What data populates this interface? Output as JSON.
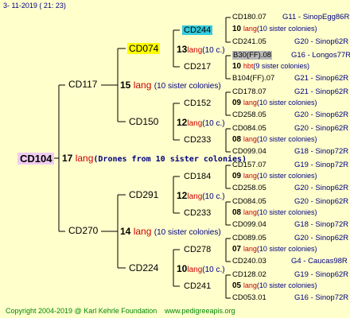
{
  "date": "3- 11-2019 (  21: 23)",
  "root": {
    "name": "CD104",
    "count": "17",
    "lang": "lang",
    "sister": "(Drones from 10 sister colonies)"
  },
  "g1": [
    {
      "name": "CD117",
      "count": "15",
      "lang": "lang",
      "sister": "(10 sister colonies)"
    },
    {
      "name": "CD270",
      "count": "14",
      "lang": "lang",
      "sister": "(10 sister colonies)"
    }
  ],
  "g2": [
    {
      "name": "CD074",
      "count": "13",
      "lang": "lang",
      "sister": "(10 c.)"
    },
    {
      "name": "CD150",
      "count": "12",
      "lang": "lang",
      "sister": "(10 c.)"
    },
    {
      "name": "CD291",
      "count": "12",
      "lang": "lang",
      "sister": "(10 c.)"
    },
    {
      "name": "CD224",
      "count": "10",
      "lang": "lang",
      "sister": "(10 c.)"
    }
  ],
  "g3": [
    {
      "name": "CD244",
      "count": "10",
      "lang": "lang",
      "sister": "(10 sister colonies)"
    },
    {
      "name": "CD217",
      "count": "10",
      "lang": "hbt",
      "sister": "(9 sister colonies)"
    },
    {
      "name": "CD152",
      "count": "09",
      "lang": "lang",
      "sister": "(10 sister colonies)"
    },
    {
      "name": "CD233",
      "count": "08",
      "lang": "lang",
      "sister": "(10 sister colonies)"
    },
    {
      "name": "CD184",
      "count": "09",
      "lang": "lang",
      "sister": "(10 sister colonies)"
    },
    {
      "name": "CD233",
      "count": "08",
      "lang": "lang",
      "sister": "(10 sister colonies)"
    },
    {
      "name": "CD278",
      "count": "07",
      "lang": "lang",
      "sister": "(10 sister colonies)"
    },
    {
      "name": "CD241",
      "count": "05",
      "lang": "lang",
      "sister": "(10 sister colonies)"
    }
  ],
  "g4": [
    {
      "name": "CD180.07",
      "code": "G11 - SinopEgg86R"
    },
    {
      "name": "CD241.05",
      "code": "G20 - Sinop62R"
    },
    {
      "name": "B30(FF).08",
      "code": "G16 - Longos77R"
    },
    {
      "name": "B104(FF).07",
      "code": "G21 - Sinop62R"
    },
    {
      "name": "CD178.07",
      "code": "G21 - Sinop62R"
    },
    {
      "name": "CD258.05",
      "code": "G20 - Sinop62R"
    },
    {
      "name": "CD084.05",
      "code": "G20 - Sinop62R"
    },
    {
      "name": "CD099.04",
      "code": "G18 - Sinop72R"
    },
    {
      "name": "CD157.07",
      "code": "G19 - Sinop72R"
    },
    {
      "name": "CD258.05",
      "code": "G20 - Sinop62R"
    },
    {
      "name": "CD084.05",
      "code": "G20 - Sinop62R"
    },
    {
      "name": "CD099.04",
      "code": "G18 - Sinop72R"
    },
    {
      "name": "CD089.05",
      "code": "G20 - Sinop62R"
    },
    {
      "name": "CD240.03",
      "code": "G4 - Caucas98R"
    },
    {
      "name": "CD128.02",
      "code": "G19 - Sinop62R"
    },
    {
      "name": "CD053.01",
      "code": "G16 - Sinop72R"
    }
  ],
  "footer": {
    "copyright": "Copyright 2004-2019 @ Karl Kehrle Foundation",
    "url": "www.pedigreeapis.org"
  }
}
